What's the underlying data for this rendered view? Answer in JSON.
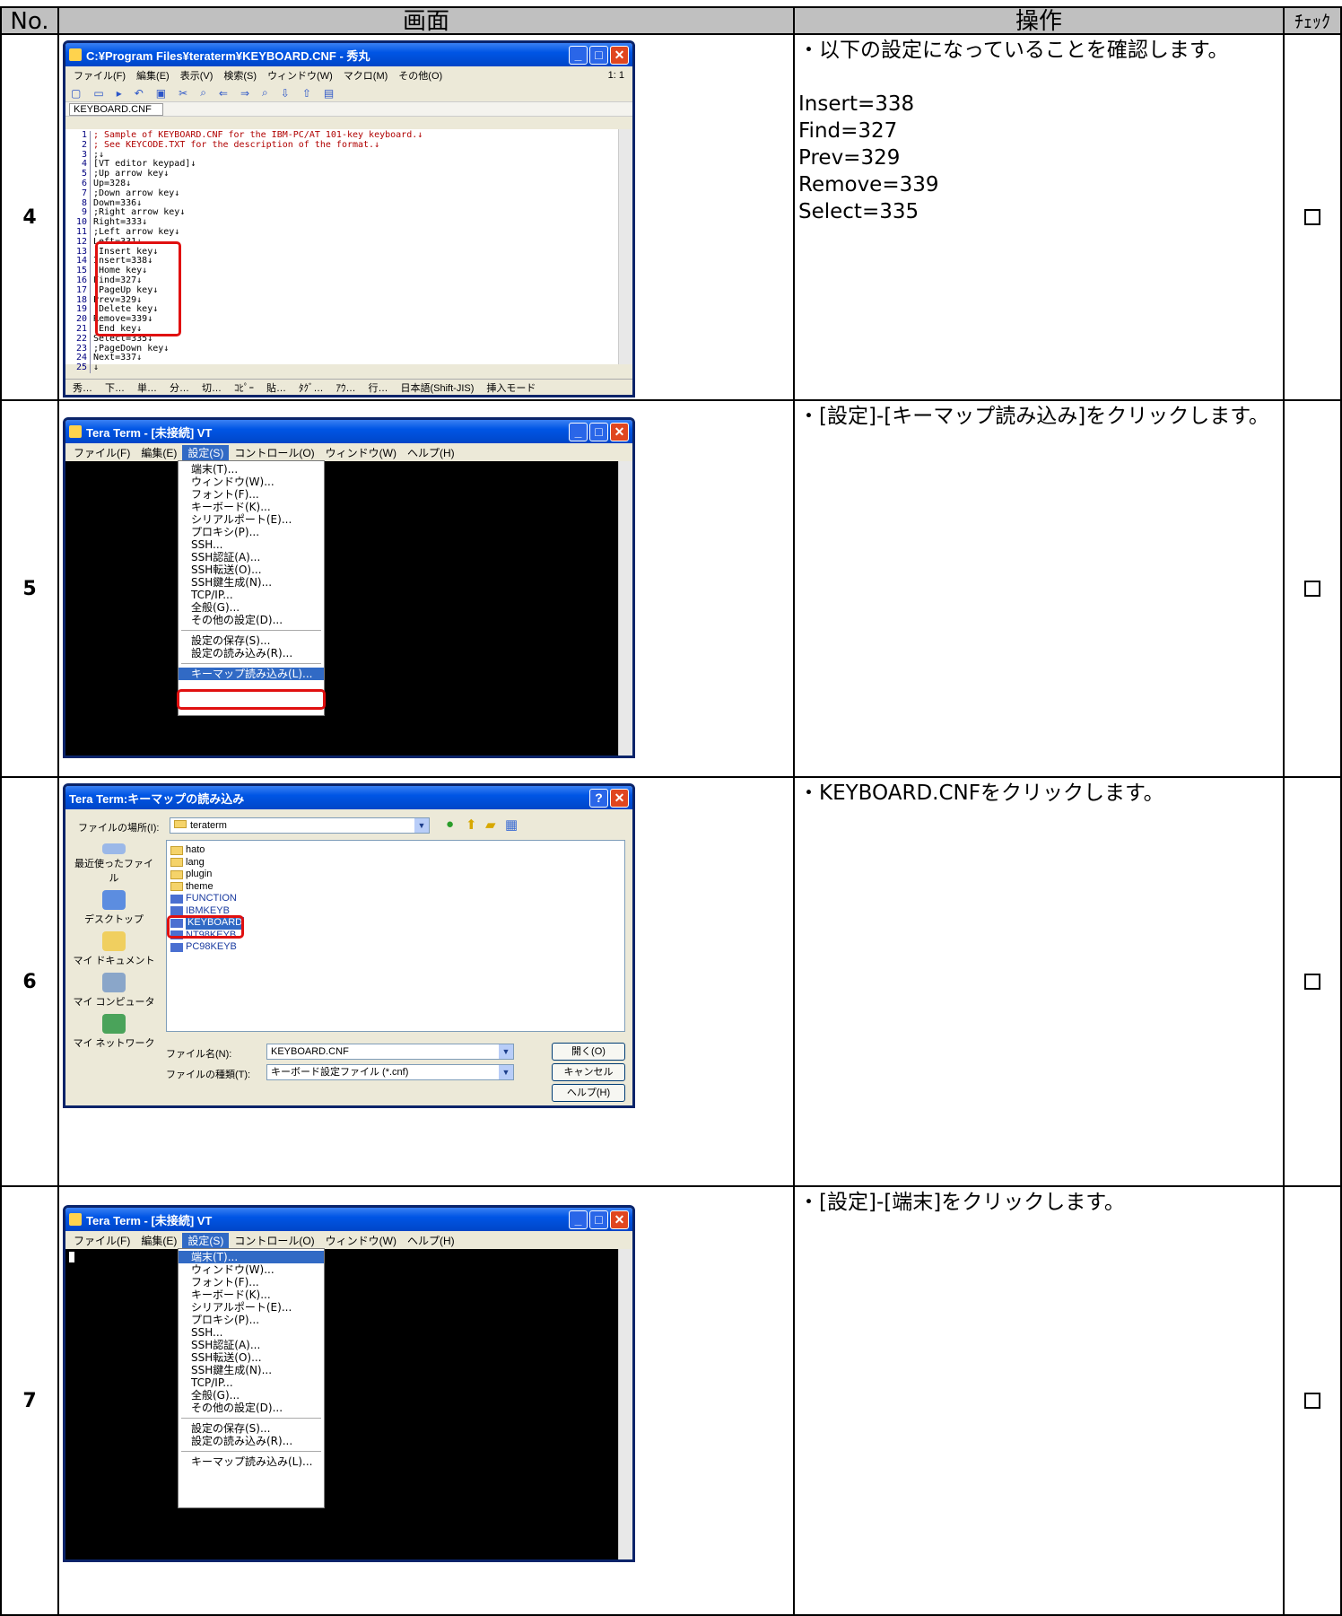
{
  "header": {
    "no": "No.",
    "screen": "画面",
    "operation": "操作",
    "check": "ﾁｪｯｸ"
  },
  "rows": [
    {
      "no": "4",
      "operation": "・以下の設定になっていることを確認します。\n\nInsert=338\nFind=327\nPrev=329\nRemove=339\nSelect=335"
    },
    {
      "no": "5",
      "operation": "・[設定]-[キーマップ読み込み]をクリックします。"
    },
    {
      "no": "6",
      "operation": "・KEYBOARD.CNFをクリックします。"
    },
    {
      "no": "7",
      "operation": "・[設定]-[端末]をクリックします。"
    }
  ],
  "editor_window": {
    "title": "C:¥Program Files¥teraterm¥KEYBOARD.CNF  - 秀丸",
    "menu": [
      "ファイル(F)",
      "編集(E)",
      "表示(V)",
      "検索(S)",
      "ウィンドウ(W)",
      "マクロ(M)",
      "その他(O)"
    ],
    "position": "1: 1",
    "tab": "KEYBOARD.CNF",
    "lines": [
      {
        "n": "1",
        "t": "; Sample of KEYBOARD.CNF for the IBM-PC/AT 101-key keyboard.↓"
      },
      {
        "n": "2",
        "t": "; See KEYCODE.TXT for the description of the format.↓"
      },
      {
        "n": "3",
        "t": ";↓"
      },
      {
        "n": "4",
        "t": "[VT editor keypad]↓"
      },
      {
        "n": "5",
        "t": ";Up arrow key↓"
      },
      {
        "n": "6",
        "t": "Up=328↓"
      },
      {
        "n": "7",
        "t": ";Down arrow key↓"
      },
      {
        "n": "8",
        "t": "Down=336↓"
      },
      {
        "n": "9",
        "t": ";Right arrow key↓"
      },
      {
        "n": "10",
        "t": "Right=333↓"
      },
      {
        "n": "11",
        "t": ";Left arrow key↓"
      },
      {
        "n": "12",
        "t": "Left=331↓"
      },
      {
        "n": "13",
        "t": ";Insert key↓"
      },
      {
        "n": "14",
        "t": "Insert=338↓"
      },
      {
        "n": "15",
        "t": ";Home key↓"
      },
      {
        "n": "16",
        "t": "Find=327↓"
      },
      {
        "n": "17",
        "t": ";PageUp key↓"
      },
      {
        "n": "18",
        "t": "Prev=329↓"
      },
      {
        "n": "19",
        "t": ";Delete key↓"
      },
      {
        "n": "20",
        "t": "Remove=339↓"
      },
      {
        "n": "21",
        "t": ";End key↓"
      },
      {
        "n": "22",
        "t": "Select=335↓"
      },
      {
        "n": "23",
        "t": ";PageDown key↓"
      },
      {
        "n": "24",
        "t": "Next=337↓"
      },
      {
        "n": "25",
        "t": "↓"
      }
    ],
    "status": [
      "秀…",
      "下…",
      "単…",
      "分…",
      "切…",
      "ｺﾋﾟｰ",
      "貼…",
      "ﾀｸﾞ…",
      "ｱｳ…",
      "行…",
      "日本語(Shift-JIS)",
      "挿入モード"
    ]
  },
  "teraterm": {
    "title": "Tera Term - [未接続] VT",
    "menu": [
      "ファイル(F)",
      "編集(E)",
      "設定(S)",
      "コントロール(O)",
      "ウィンドウ(W)",
      "ヘルプ(H)"
    ],
    "settings_menu": [
      "端末(T)...",
      "ウィンドウ(W)...",
      "フォント(F)...",
      "キーボード(K)...",
      "シリアルポート(E)...",
      "プロキシ(P)...",
      "SSH...",
      "SSH認証(A)...",
      "SSH転送(O)...",
      "SSH鍵生成(N)...",
      "TCP/IP...",
      "全般(G)...",
      "その他の設定(D)..."
    ],
    "settings_menu2": [
      "設定の保存(S)...",
      "設定の読み込み(R)..."
    ],
    "settings_menu3": [
      "キーマップ読み込み(L)..."
    ]
  },
  "open_dialog": {
    "title": "Tera Term:キーマップの読み込み",
    "location_label": "ファイルの場所(I):",
    "location": "teraterm",
    "places": [
      "最近使ったファイル",
      "デスクトップ",
      "マイ ドキュメント",
      "マイ コンピュータ",
      "マイ ネットワーク"
    ],
    "folders": [
      "hato",
      "lang",
      "plugin",
      "theme"
    ],
    "files": [
      "FUNCTION",
      "IBMKEYB",
      "KEYBOARD",
      "NT98KEYB",
      "PC98KEYB"
    ],
    "filename_label": "ファイル名(N):",
    "filename": "KEYBOARD.CNF",
    "filetype_label": "ファイルの種類(T):",
    "filetype": "キーボード設定ファイル (*.cnf)",
    "open": "開く(O)",
    "cancel": "キャンセル",
    "help": "ヘルプ(H)"
  }
}
